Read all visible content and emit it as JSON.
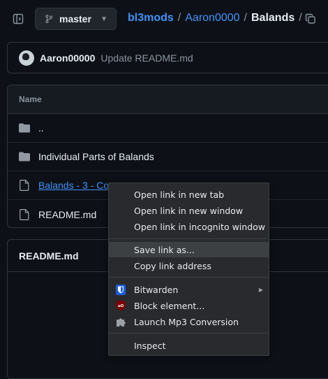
{
  "header": {
    "branch": "master",
    "breadcrumb": {
      "repo": "bl3mods",
      "sep1": "/",
      "folder": "Aaron0000",
      "sep2": "/",
      "current": "Balands",
      "sep3": "/"
    }
  },
  "commit": {
    "author": "Aaron00000",
    "message": "Update README.md"
  },
  "files": {
    "header": "Name",
    "rows": [
      {
        "type": "folder",
        "name": ".."
      },
      {
        "type": "folder",
        "name": "Individual Parts of Balands"
      },
      {
        "type": "file",
        "name": "Balands - 3 - Com..."
      },
      {
        "type": "file",
        "name": "README.md"
      }
    ]
  },
  "readme": {
    "title": "README.md"
  },
  "context_menu": {
    "items": [
      {
        "label": "Open link in new tab"
      },
      {
        "label": "Open link in new window"
      },
      {
        "label": "Open link in incognito window"
      },
      {
        "label": "Save link as..."
      },
      {
        "label": "Copy link address"
      },
      {
        "label": "Bitwarden"
      },
      {
        "label": "Block element..."
      },
      {
        "label": "Launch Mp3 Conversion"
      },
      {
        "label": "Inspect"
      }
    ]
  },
  "colors": {
    "background": "#0d1117",
    "link": "#4493f8",
    "border": "#30363d",
    "menu_bg": "#292a2d",
    "menu_hover": "#3c4043"
  }
}
